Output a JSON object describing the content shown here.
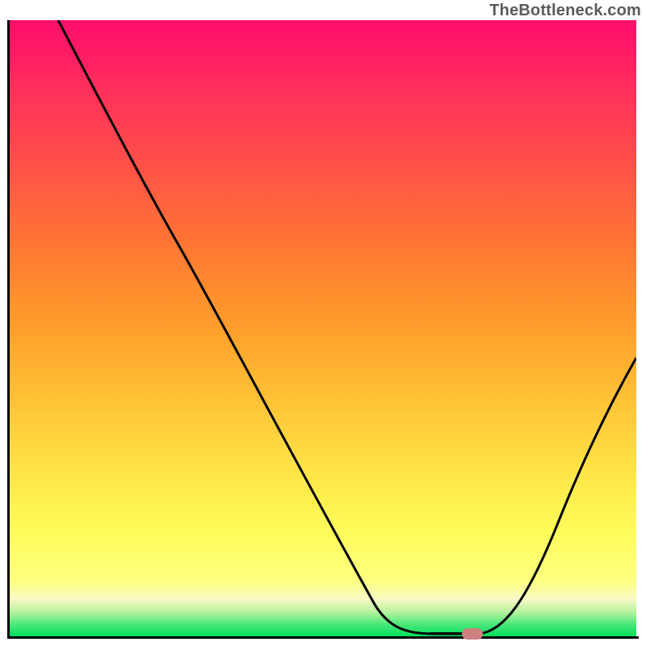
{
  "chart_data": {
    "type": "line",
    "watermark": "TheBottleneck.com",
    "title": "",
    "xlabel": "",
    "ylabel": "",
    "xlim": [
      0,
      100
    ],
    "ylim": [
      0,
      100
    ],
    "axes_visible": {
      "left": true,
      "bottom": true,
      "top": false,
      "right": false,
      "ticks": false,
      "labels": false
    },
    "background_gradient": {
      "direction": "vertical-bottom-to-top",
      "stops": [
        {
          "pos": 0,
          "color": "#00e05d"
        },
        {
          "pos": 3,
          "color": "#4de87a"
        },
        {
          "pos": 6,
          "color": "#f8fac6"
        },
        {
          "pos": 10,
          "color": "#ffff80"
        },
        {
          "pos": 30,
          "color": "#ffd23d"
        },
        {
          "pos": 50,
          "color": "#ffa22c"
        },
        {
          "pos": 70,
          "color": "#ff5b42"
        },
        {
          "pos": 90,
          "color": "#ff2f5b"
        },
        {
          "pos": 100,
          "color": "#ff0f6b"
        }
      ]
    },
    "series": [
      {
        "name": "bottleneck-curve",
        "color": "#000000",
        "x": [
          8,
          15,
          22,
          27,
          35,
          45,
          55,
          62,
          66,
          70,
          74,
          78,
          83,
          88,
          93,
          100
        ],
        "values": [
          100,
          85,
          72,
          63,
          52,
          38,
          20,
          8,
          2,
          0.5,
          0.3,
          0.5,
          4,
          18,
          35,
          46
        ]
      }
    ],
    "marker": {
      "x": 73,
      "y": 0.3,
      "name": "optimal-point",
      "color": "#cc8080",
      "shape": "rounded-rect"
    },
    "optimal_range_x": [
      68,
      75
    ]
  }
}
